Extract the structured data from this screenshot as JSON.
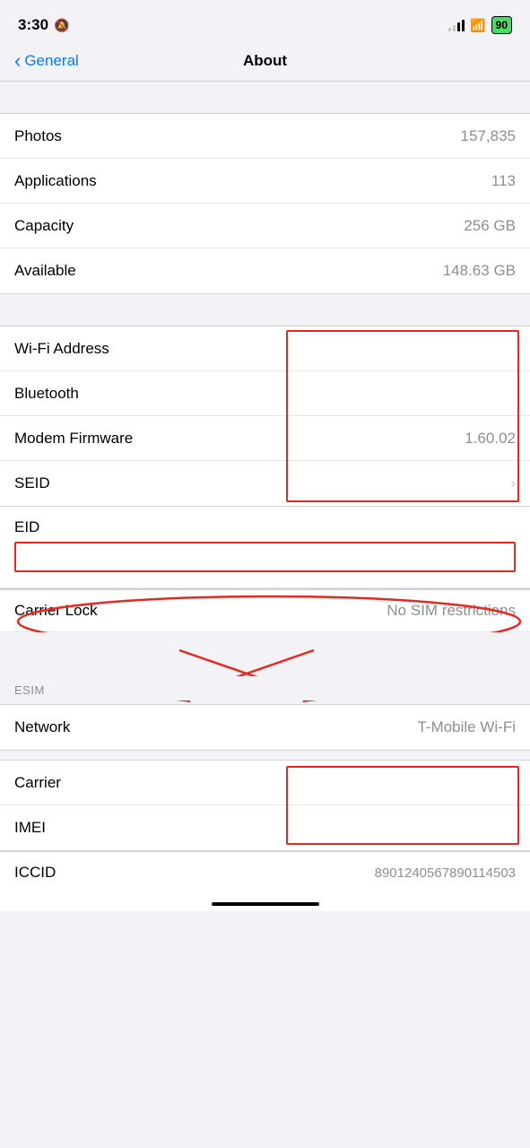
{
  "statusBar": {
    "time": "3:30",
    "battery": "90"
  },
  "header": {
    "backLabel": "General",
    "title": "About"
  },
  "group1": {
    "rows": [
      {
        "label": "Photos",
        "value": "157,835"
      },
      {
        "label": "Applications",
        "value": "113"
      },
      {
        "label": "Capacity",
        "value": "256 GB"
      },
      {
        "label": "Available",
        "value": "148.63 GB"
      }
    ]
  },
  "group2": {
    "wifiLabel": "Wi-Fi Address",
    "bluetoothLabel": "Bluetooth",
    "modemLabel": "Modem Firmware",
    "modemValue": "1.60.02",
    "seidLabel": "SEID",
    "eidLabel": "EID"
  },
  "group3": {
    "carrierLockLabel": "Carrier Lock",
    "carrierLockValue": "No SIM restrictions",
    "esimHeader": "ESIM",
    "networkLabel": "Network",
    "networkValue": "T-Mobile Wi-Fi",
    "carrierLabel": "Carrier",
    "imeiLabel": "IMEI",
    "iccidLabel": "ICCID",
    "iccidValue": "8901240567890114503"
  }
}
